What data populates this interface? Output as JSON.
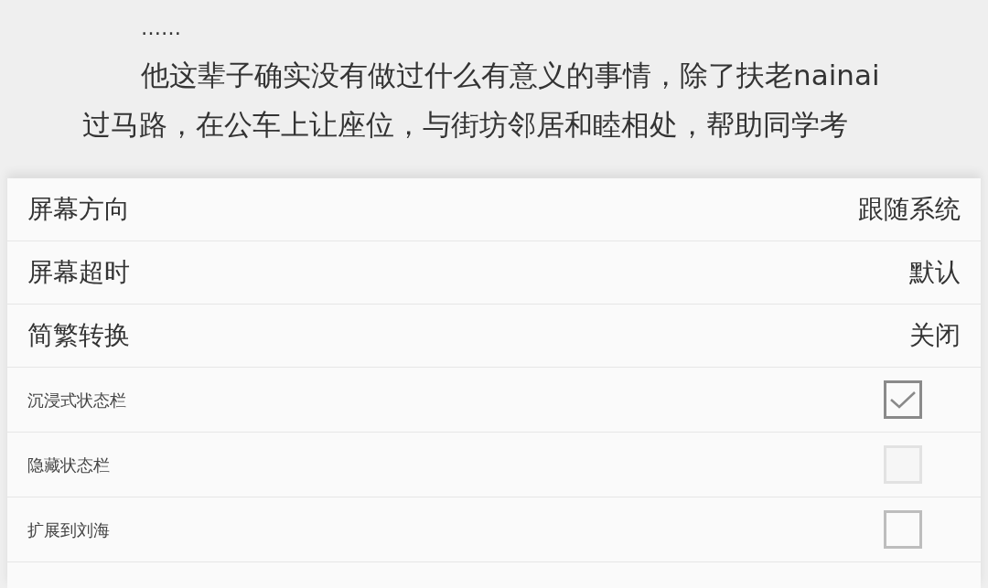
{
  "reader": {
    "ellipsis": "……",
    "paragraph": "他这辈子确实没有做过什么有意义的事情，除了扶老nainai过马路，在公车上让座位，与街坊邻居和睦相处，帮助同学考"
  },
  "settings": [
    {
      "kind": "value",
      "label": "屏幕方向",
      "value": "跟随系统"
    },
    {
      "kind": "value",
      "label": "屏幕超时",
      "value": "默认"
    },
    {
      "kind": "value",
      "label": "简繁转换",
      "value": "关闭"
    },
    {
      "kind": "checkbox",
      "label": "沉浸式状态栏",
      "checked": true,
      "disabled": false
    },
    {
      "kind": "checkbox",
      "label": "隐藏状态栏",
      "checked": false,
      "disabled": true
    },
    {
      "kind": "checkbox",
      "label": "扩展到刘海",
      "checked": false,
      "disabled": false
    }
  ]
}
